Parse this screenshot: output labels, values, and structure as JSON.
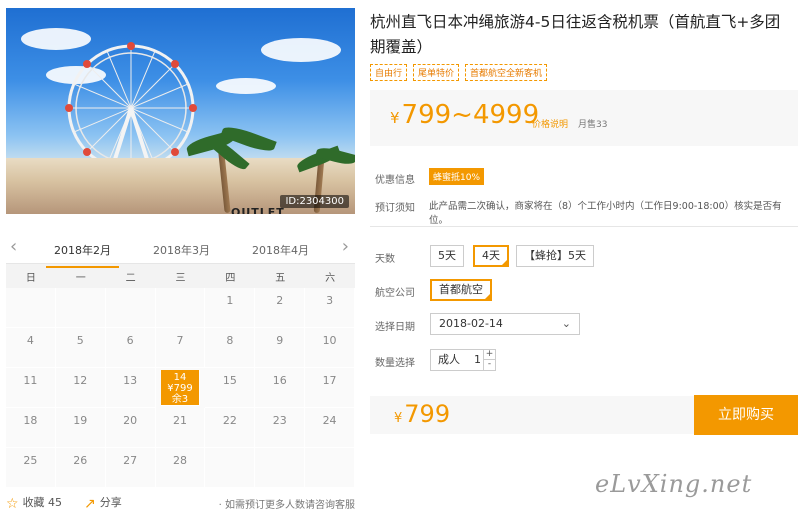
{
  "photo": {
    "id_label": "ID:2304300",
    "sign_text": "OUTLET"
  },
  "calendar": {
    "prev_icon": "chevron-left-icon",
    "next_icon": "chevron-right-icon",
    "months": [
      "2018年2月",
      "2018年3月",
      "2018年4月"
    ],
    "weekdays": [
      "日",
      "一",
      "二",
      "三",
      "四",
      "五",
      "六"
    ],
    "days": [
      "",
      "",
      "",
      "",
      "1",
      "2",
      "3",
      "4",
      "5",
      "6",
      "7",
      "8",
      "9",
      "10",
      "11",
      "12",
      "13",
      "14",
      "15",
      "16",
      "17",
      "18",
      "19",
      "20",
      "21",
      "22",
      "23",
      "24",
      "25",
      "26",
      "27",
      "28",
      "",
      "",
      ""
    ],
    "selected": {
      "day": "14",
      "price": "¥799",
      "stock": "余3"
    },
    "accent_color": "#f39800"
  },
  "footer": {
    "fav_icon": "star-icon",
    "fav_label": "收藏 45",
    "share_icon": "share-icon",
    "share_label": "分享",
    "hint": "· 如需预订更多人数请咨询客服"
  },
  "product": {
    "title": "杭州直飞日本冲绳旅游4-5日往返含税机票（首航直飞+多团期覆盖）",
    "tags": [
      "自由行",
      "尾单特价",
      "首都航空全新客机"
    ],
    "price_currency": "¥",
    "price_range": "799~4999",
    "price_note": "价格说明",
    "monthly_sales": "月售33",
    "discount_label": "优惠信息",
    "discount_badge": "蜂蜜抵10%",
    "notice_label": "预订须知",
    "notice_text": "此产品需二次确认，商家将在（8）个工作小时内（工作日9:00-18:00）核实是否有位。"
  },
  "options": {
    "days_label": "天数",
    "days": [
      "5天",
      "4天",
      "【蜂抢】5天"
    ],
    "selected_day": "4天",
    "airline_label": "航空公司",
    "airline": "首都航空",
    "date_label": "选择日期",
    "date_value": "2018-02-14",
    "qty_label": "数量选择",
    "qty_type": "成人",
    "qty_value": "1",
    "qty_plus": "+",
    "qty_minus": "-"
  },
  "buy": {
    "currency": "¥",
    "price": "799",
    "button": "立即购买"
  },
  "watermark": "eLvXing.net"
}
